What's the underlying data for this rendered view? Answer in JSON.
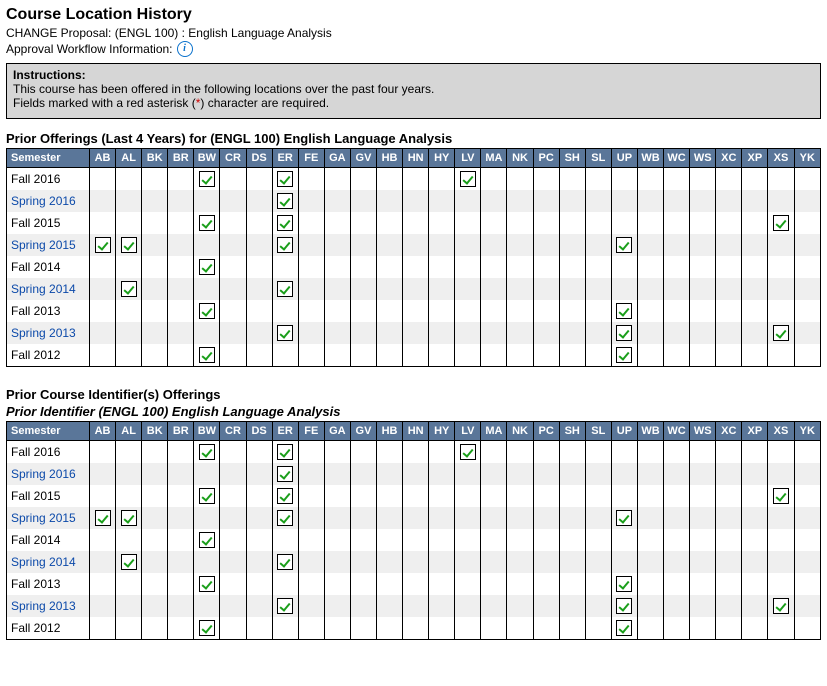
{
  "header": {
    "title": "Course Location History",
    "proposal": "CHANGE Proposal: (ENGL 100) : English Language Analysis",
    "approval_label": "Approval Workflow Information:"
  },
  "instructions": {
    "heading": "Instructions:",
    "line1": "This course has been offered in the following locations over the past four years.",
    "line2_a": "Fields marked with a red asterisk (",
    "line2_star": "*",
    "line2_b": ") character are required."
  },
  "columns": [
    "AB",
    "AL",
    "BK",
    "BR",
    "BW",
    "CR",
    "DS",
    "ER",
    "FE",
    "GA",
    "GV",
    "HB",
    "HN",
    "HY",
    "LV",
    "MA",
    "NK",
    "PC",
    "SH",
    "SL",
    "UP",
    "WB",
    "WC",
    "WS",
    "XC",
    "XP",
    "XS",
    "YK"
  ],
  "semester_header": "Semester",
  "table1": {
    "heading": "Prior Offerings (Last 4 Years) for (ENGL 100) English Language Analysis",
    "rows": [
      {
        "label": "Fall 2016",
        "link": false,
        "checks": [
          "BW",
          "ER",
          "LV"
        ]
      },
      {
        "label": "Spring 2016",
        "link": true,
        "checks": [
          "ER"
        ]
      },
      {
        "label": "Fall 2015",
        "link": false,
        "checks": [
          "BW",
          "ER",
          "XS"
        ]
      },
      {
        "label": "Spring 2015",
        "link": true,
        "checks": [
          "AB",
          "AL",
          "ER",
          "UP"
        ]
      },
      {
        "label": "Fall 2014",
        "link": false,
        "checks": [
          "BW"
        ]
      },
      {
        "label": "Spring 2014",
        "link": true,
        "checks": [
          "AL",
          "ER"
        ]
      },
      {
        "label": "Fall 2013",
        "link": false,
        "checks": [
          "BW",
          "UP"
        ]
      },
      {
        "label": "Spring 2013",
        "link": true,
        "checks": [
          "ER",
          "UP",
          "XS"
        ]
      },
      {
        "label": "Fall 2012",
        "link": false,
        "checks": [
          "BW",
          "UP"
        ]
      }
    ]
  },
  "table2": {
    "heading": "Prior Course Identifier(s) Offerings",
    "subheading": "Prior Identifier (ENGL 100) English Language Analysis",
    "rows": [
      {
        "label": "Fall 2016",
        "link": false,
        "checks": [
          "BW",
          "ER",
          "LV"
        ]
      },
      {
        "label": "Spring 2016",
        "link": true,
        "checks": [
          "ER"
        ]
      },
      {
        "label": "Fall 2015",
        "link": false,
        "checks": [
          "BW",
          "ER",
          "XS"
        ]
      },
      {
        "label": "Spring 2015",
        "link": true,
        "checks": [
          "AB",
          "AL",
          "ER",
          "UP"
        ]
      },
      {
        "label": "Fall 2014",
        "link": false,
        "checks": [
          "BW"
        ]
      },
      {
        "label": "Spring 2014",
        "link": true,
        "checks": [
          "AL",
          "ER"
        ]
      },
      {
        "label": "Fall 2013",
        "link": false,
        "checks": [
          "BW",
          "UP"
        ]
      },
      {
        "label": "Spring 2013",
        "link": true,
        "checks": [
          "ER",
          "UP",
          "XS"
        ]
      },
      {
        "label": "Fall 2012",
        "link": false,
        "checks": [
          "BW",
          "UP"
        ]
      }
    ]
  }
}
